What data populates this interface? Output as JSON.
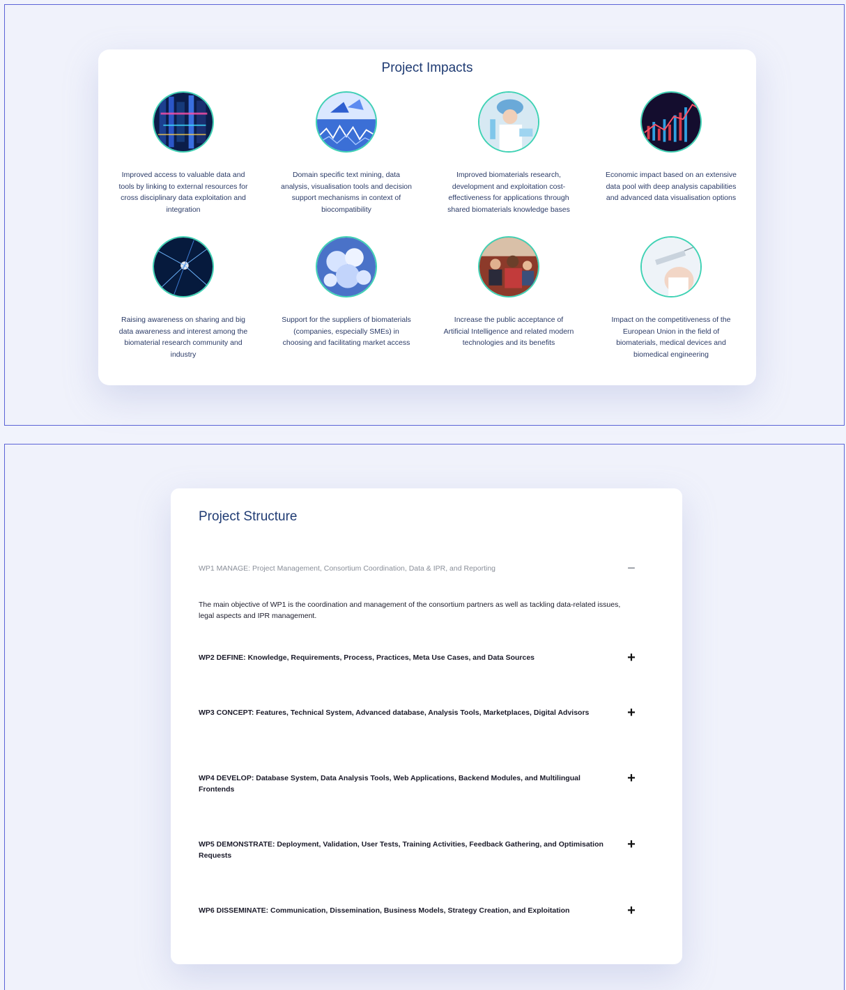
{
  "impacts": {
    "title": "Project Impacts",
    "items": [
      {
        "text": "Improved access to valuable data and tools by linking to external resources for cross disciplinary data exploitation and integration",
        "icon": "server-data-image"
      },
      {
        "text": "Domain specific text mining, data analysis, visualisation tools and decision support mechanisms in context of biocompatibility",
        "icon": "analytics-image"
      },
      {
        "text": "Improved biomaterials research, development and exploitation cost-effectiveness for applications through shared biomaterials knowledge bases",
        "icon": "lab-research-image"
      },
      {
        "text": "Economic impact based on an extensive data pool with deep analysis capabilities and advanced data visualisation options",
        "icon": "finance-chart-image"
      },
      {
        "text": "Raising awareness on sharing and big data awareness and interest among the biomaterial research community and industry",
        "icon": "neural-network-image"
      },
      {
        "text": "Support for the suppliers of biomaterials (companies, especially SMEs) in choosing and facilitating market access",
        "icon": "crystals-image"
      },
      {
        "text": "Increase the public acceptance of Artificial Intelligence and related modern technologies and its benefits",
        "icon": "audience-image"
      },
      {
        "text": "Impact on the competitiveness of the European Union in the field of biomaterials, medical devices and biomedical engineering",
        "icon": "syringe-image"
      }
    ]
  },
  "structure": {
    "title": "Project Structure",
    "items": [
      {
        "label": "WP1 MANAGE: Project Management, Consortium Coordination, Data & IPR, and Reporting",
        "toggle": "−",
        "expanded": true,
        "body": "The main objective of WP1 is the coordination and management of the consortium partners as well as tackling data-related issues, legal aspects and IPR management."
      },
      {
        "label": "WP2 DEFINE: Knowledge, Requirements, Process, Practices, Meta Use Cases, and Data Sources",
        "toggle": "+"
      },
      {
        "label": "WP3 CONCEPT: Features, Technical System, Advanced database, Analysis Tools, Marketplaces, Digital Advisors",
        "toggle": "+"
      },
      {
        "label": "WP4 DEVELOP: Database System, Data Analysis Tools, Web Applications, Backend Modules, and Multilingual Frontends",
        "toggle": "+"
      },
      {
        "label": "WP5 DEMONSTRATE: Deployment, Validation, User Tests, Training Activities, Feedback Gathering, and Optimisation Requests",
        "toggle": "+"
      },
      {
        "label": "WP6 DISSEMINATE: Communication, Dissemination, Business Models, Strategy Creation, and Exploitation",
        "toggle": "+"
      }
    ]
  },
  "colors": {
    "accent": "#3fd2b4",
    "title": "#1f3b73",
    "frame": "#5b63d6"
  }
}
